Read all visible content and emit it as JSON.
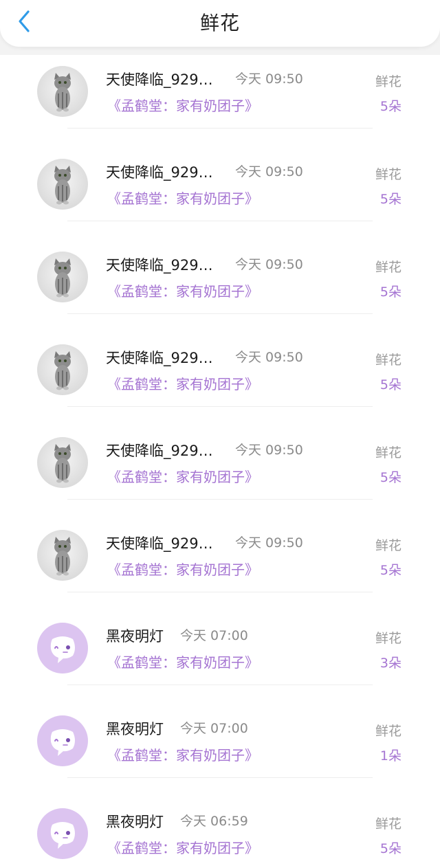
{
  "header": {
    "title": "鲜花"
  },
  "entries": [
    {
      "avatar": "cat-avatar",
      "name": "天使降临_929…",
      "time": "今天 09:50",
      "desc": "《孟鹤堂：家有奶团子》",
      "type": "鲜花",
      "count": "5朵"
    },
    {
      "avatar": "cat-avatar",
      "name": "天使降临_929…",
      "time": "今天 09:50",
      "desc": "《孟鹤堂：家有奶团子》",
      "type": "鲜花",
      "count": "5朵"
    },
    {
      "avatar": "cat-avatar",
      "name": "天使降临_929…",
      "time": "今天 09:50",
      "desc": "《孟鹤堂：家有奶团子》",
      "type": "鲜花",
      "count": "5朵"
    },
    {
      "avatar": "cat-avatar",
      "name": "天使降临_929…",
      "time": "今天 09:50",
      "desc": "《孟鹤堂：家有奶团子》",
      "type": "鲜花",
      "count": "5朵"
    },
    {
      "avatar": "cat-avatar",
      "name": "天使降临_929…",
      "time": "今天 09:50",
      "desc": "《孟鹤堂：家有奶团子》",
      "type": "鲜花",
      "count": "5朵"
    },
    {
      "avatar": "cat-avatar",
      "name": "天使降临_929…",
      "time": "今天 09:50",
      "desc": "《孟鹤堂：家有奶团子》",
      "type": "鲜花",
      "count": "5朵"
    },
    {
      "avatar": "chat-bubble-avatar",
      "name": "黑夜明灯",
      "time": "今天 07:00",
      "desc": "《孟鹤堂：家有奶团子》",
      "type": "鲜花",
      "count": "3朵"
    },
    {
      "avatar": "chat-bubble-avatar",
      "name": "黑夜明灯",
      "time": "今天 07:00",
      "desc": "《孟鹤堂：家有奶团子》",
      "type": "鲜花",
      "count": "1朵"
    },
    {
      "avatar": "chat-bubble-avatar",
      "name": "黑夜明灯",
      "time": "今天 06:59",
      "desc": "《孟鹤堂：家有奶团子》",
      "type": "鲜花",
      "count": "5朵"
    }
  ],
  "colors": {
    "accent": "#a574d2",
    "back_arrow": "#2f9be8",
    "chat_avatar_bg": "#dcc4f0"
  }
}
